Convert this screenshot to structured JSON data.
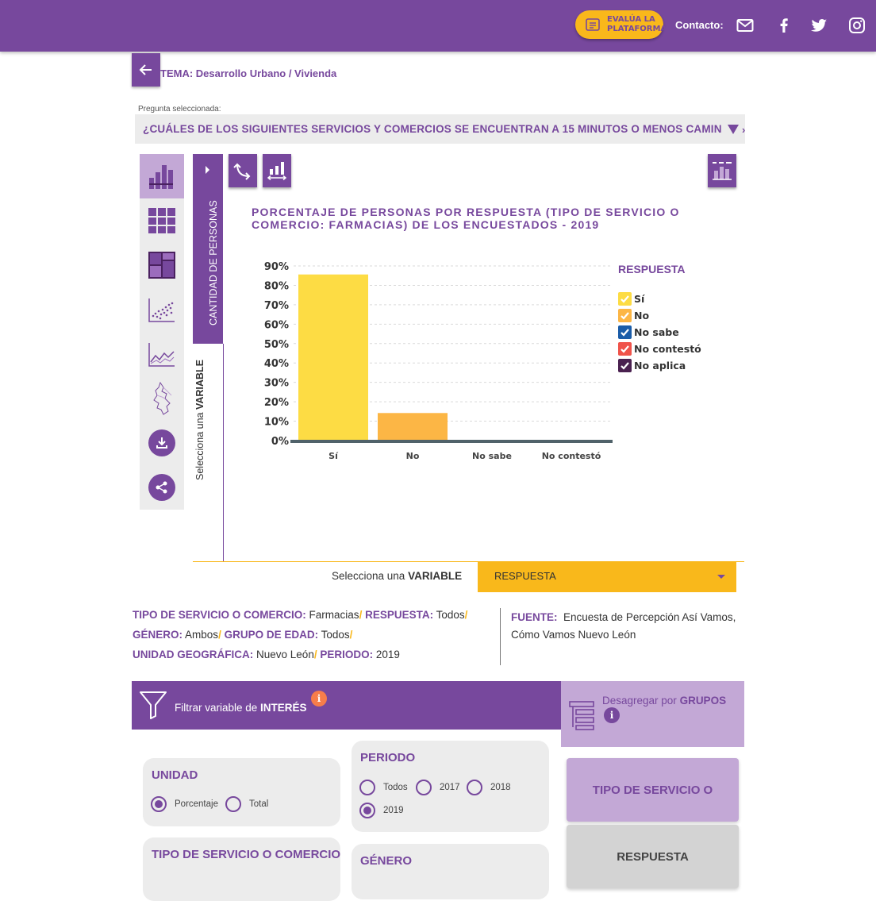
{
  "header": {
    "evaluate_label": "EVALÚA LA PLATAFORMA",
    "contact_label": "Contacto:",
    "icons": [
      "mail-icon",
      "facebook-icon",
      "twitter-icon",
      "instagram-icon"
    ]
  },
  "topic": {
    "label": "TEMA:",
    "value": "Desarrollo Urbano / Vivienda"
  },
  "question": {
    "label": "Pregunta seleccionada:",
    "text": "¿CUÁLES DE LOS SIGUIENTES SERVICIOS Y COMERCIOS SE ENCUENTRAN A 15 MINUTOS O MENOS CAMIN",
    "overflow_text": "›"
  },
  "variable_strip": {
    "label": "CANTIDAD DE PERSONAS",
    "select_prefix": "Selecciona una ",
    "select_strong": "VARIABLE"
  },
  "chart_data": {
    "type": "bar",
    "title": "PORCENTAJE DE PERSONAS POR RESPUESTA (TIPO DE SERVICIO O COMERCIO: FARMACIAS) DE LOS ENCUESTADOS - 2019",
    "categories": [
      "Sí",
      "No",
      "No sabe",
      "No contestó"
    ],
    "values": [
      85.6,
      14.2,
      0.1,
      0.2
    ],
    "colors": [
      "#fddc44",
      "#fcb645",
      "#1a5ca8",
      "#f0534a"
    ],
    "ylim": [
      0,
      90
    ],
    "yticks": [
      "0%",
      "10%",
      "20%",
      "30%",
      "40%",
      "50%",
      "60%",
      "70%",
      "80%",
      "90%"
    ],
    "grid": true,
    "legend_placement": "right",
    "legend": {
      "title": "RESPUESTA",
      "items": [
        {
          "label": "Sí",
          "color": "#fddc44"
        },
        {
          "label": "No",
          "color": "#fcb645"
        },
        {
          "label": "No sabe",
          "color": "#1a5ca8"
        },
        {
          "label": "No contestó",
          "color": "#f0534a"
        },
        {
          "label": "No aplica",
          "color": "#4a2150"
        }
      ]
    }
  },
  "variable_select": {
    "prefix": "Selecciona una ",
    "strong": "VARIABLE",
    "selected": "RESPUESTA"
  },
  "info": {
    "tipo_key": "TIPO DE SERVICIO O COMERCIO:",
    "tipo_val": "Farmacias",
    "respuesta_key": "RESPUESTA:",
    "respuesta_val": "Todos",
    "genero_key": "GÉNERO:",
    "genero_val": "Ambos",
    "edad_key": "GRUPO DE EDAD:",
    "edad_val": "Todos",
    "unidad_key": "UNIDAD GEOGRÁFICA:",
    "unidad_val": "Nuevo León",
    "periodo_key": "PERIODO:",
    "periodo_val": "2019",
    "sep": "/",
    "fuente_key": "FUENTE:",
    "fuente_val": "Encuesta de Percepción Así Vamos, Cómo Vamos Nuevo León"
  },
  "filters": {
    "filtrar_prefix": "Filtrar variable de ",
    "filtrar_strong": "INTERÉS",
    "info_glyph": "i",
    "desagregar_prefix": "Desagregar por ",
    "desagregar_strong": "GRUPOS",
    "unidad": {
      "title": "UNIDAD",
      "options": [
        "Porcentaje",
        "Total"
      ],
      "selected": "Porcentaje"
    },
    "periodo": {
      "title": "PERIODO",
      "options": [
        "Todos",
        "2017",
        "2018",
        "2019"
      ],
      "selected": "2019"
    },
    "tipo": {
      "title": "TIPO DE SERVICIO O COMERCIO"
    },
    "genero": {
      "title": "GÉNERO"
    },
    "group_buttons": [
      {
        "label": "TIPO DE SERVICIO O",
        "active": true
      },
      {
        "label": "RESPUESTA",
        "active": false
      }
    ]
  }
}
